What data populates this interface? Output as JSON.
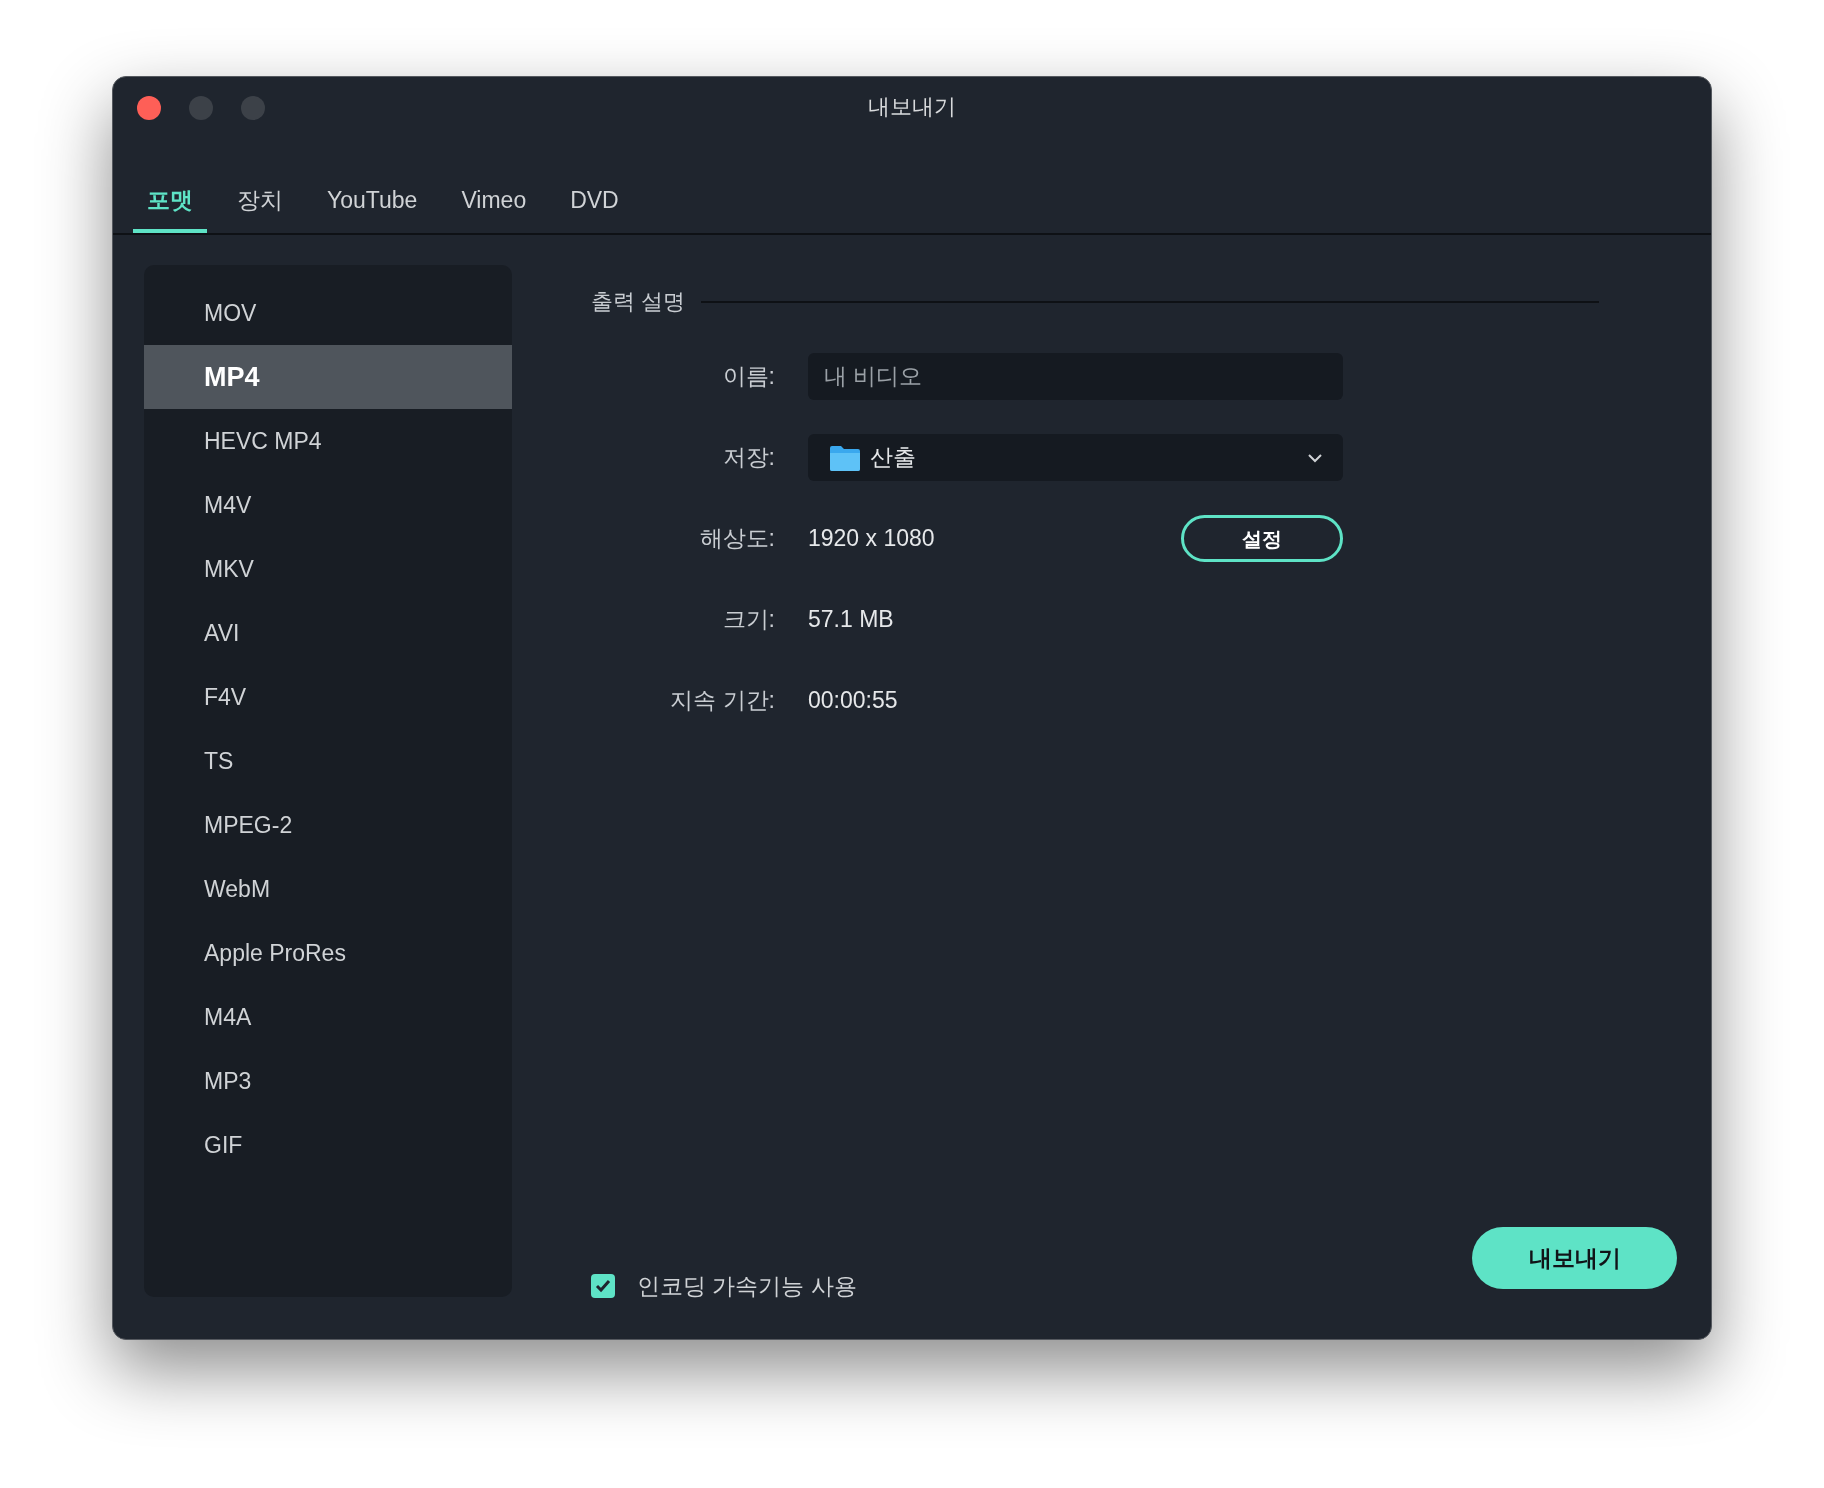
{
  "window": {
    "title": "내보내기"
  },
  "tabs": [
    {
      "label": "포맷",
      "selected": true
    },
    {
      "label": "장치",
      "selected": false
    },
    {
      "label": "YouTube",
      "selected": false
    },
    {
      "label": "Vimeo",
      "selected": false
    },
    {
      "label": "DVD",
      "selected": false
    }
  ],
  "formats": [
    {
      "label": "MOV",
      "selected": false
    },
    {
      "label": "MP4",
      "selected": true
    },
    {
      "label": "HEVC MP4",
      "selected": false
    },
    {
      "label": "M4V",
      "selected": false
    },
    {
      "label": "MKV",
      "selected": false
    },
    {
      "label": "AVI",
      "selected": false
    },
    {
      "label": "F4V",
      "selected": false
    },
    {
      "label": "TS",
      "selected": false
    },
    {
      "label": "MPEG-2",
      "selected": false
    },
    {
      "label": "WebM",
      "selected": false
    },
    {
      "label": "Apple ProRes",
      "selected": false
    },
    {
      "label": "M4A",
      "selected": false
    },
    {
      "label": "MP3",
      "selected": false
    },
    {
      "label": "GIF",
      "selected": false
    }
  ],
  "section_title": "출력 설명",
  "fields": [
    {
      "kind": "input",
      "label": "이름:",
      "value": "내 비디오"
    },
    {
      "kind": "folder",
      "label": "저장:",
      "value": "산출"
    },
    {
      "kind": "button",
      "label": "해상도:",
      "value": "1920 x 1080",
      "button": "설정"
    },
    {
      "kind": "text",
      "label": "크기:",
      "value": "57.1 MB"
    },
    {
      "kind": "text",
      "label": "지속 기간:",
      "value": "00:00:55"
    }
  ],
  "acceleration": {
    "label": "인코딩 가속기능 사용",
    "checked": true
  },
  "export_button": "내보내기"
}
